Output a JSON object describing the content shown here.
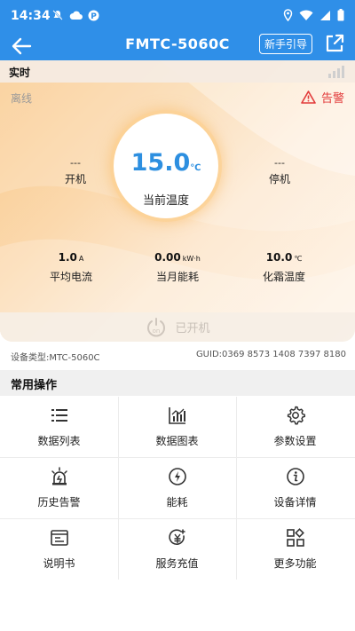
{
  "status_bar": {
    "time": "14:34"
  },
  "nav": {
    "title": "FMTC-5060C",
    "guide_label": "新手引导"
  },
  "realtime": {
    "header_label": "实时",
    "status_text": "离线",
    "alarm_label": "告警",
    "gauge_value": "15.0",
    "gauge_unit": "℃",
    "gauge_caption": "当前温度",
    "start": {
      "value": "---",
      "label": "开机"
    },
    "stop": {
      "value": "---",
      "label": "停机"
    },
    "metrics": [
      {
        "value": "1.0",
        "unit": "A",
        "label": "平均电流"
      },
      {
        "value": "0.00",
        "unit": "kW·h",
        "label": "当月能耗"
      },
      {
        "value": "10.0",
        "unit": "℃",
        "label": "化霜温度"
      }
    ],
    "power_state": "已开机",
    "power_icon_text": "on"
  },
  "device": {
    "type": "设备类型:MTC-5060C",
    "guid": "GUID:0369 8573 1408 7397 8180"
  },
  "operations": {
    "title": "常用操作",
    "items": [
      {
        "label": "数据列表",
        "icon": "list-icon"
      },
      {
        "label": "数据图表",
        "icon": "bar-chart-icon"
      },
      {
        "label": "参数设置",
        "icon": "gear-icon"
      },
      {
        "label": "历史告警",
        "icon": "alarm-lamp-icon"
      },
      {
        "label": "能耗",
        "icon": "lightning-icon"
      },
      {
        "label": "设备详情",
        "icon": "info-icon"
      },
      {
        "label": "说明书",
        "icon": "manual-icon"
      },
      {
        "label": "服务充值",
        "icon": "yuan-recharge-icon"
      },
      {
        "label": "更多功能",
        "icon": "grid-apps-icon"
      }
    ]
  },
  "colors": {
    "primary": "#2f8fe8",
    "alarm": "#e23a3a",
    "gauge_value": "#2d8fe0"
  }
}
